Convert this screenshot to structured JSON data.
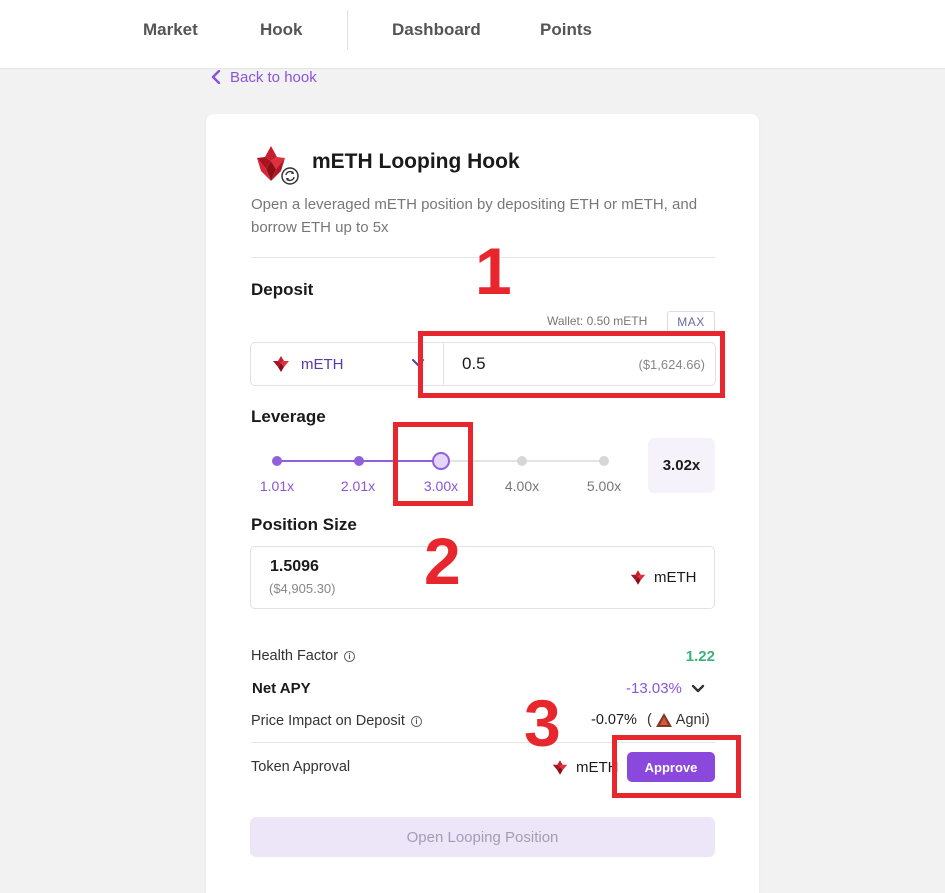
{
  "nav": {
    "items": [
      "Market",
      "Hook",
      "Dashboard",
      "Points"
    ]
  },
  "back_link": "Back to hook",
  "hook": {
    "title": "mETH Looping Hook",
    "description": "Open a leveraged mETH position by depositing ETH or mETH, and borrow ETH up to 5x"
  },
  "deposit": {
    "label": "Deposit",
    "wallet": "Wallet: 0.50 mETH",
    "max_label": "MAX",
    "token": "mETH",
    "amount": "0.5",
    "amount_usd": "($1,624.66)"
  },
  "leverage": {
    "label": "Leverage",
    "ticks": [
      "1.01x",
      "2.01x",
      "3.00x",
      "4.00x",
      "5.00x"
    ],
    "selected_index": 2,
    "value": "3.02x"
  },
  "position": {
    "label": "Position Size",
    "value": "1.5096",
    "usd": "($4,905.30)",
    "token": "mETH"
  },
  "stats": {
    "health_factor_label": "Health Factor",
    "health_factor": "1.22",
    "net_apy_label": "Net APY",
    "net_apy": "-13.03%",
    "price_impact_label": "Price Impact on Deposit",
    "price_impact": "-0.07%",
    "price_impact_source": "Agni"
  },
  "approval": {
    "label": "Token Approval",
    "token": "mETH",
    "button": "Approve"
  },
  "open_button": "Open Looping Position",
  "annotations": [
    "1",
    "2",
    "3"
  ],
  "colors": {
    "accent": "#8a55d8",
    "approve": "#8a48dd",
    "health": "#3bb27a",
    "annotation": "#e8262d"
  }
}
